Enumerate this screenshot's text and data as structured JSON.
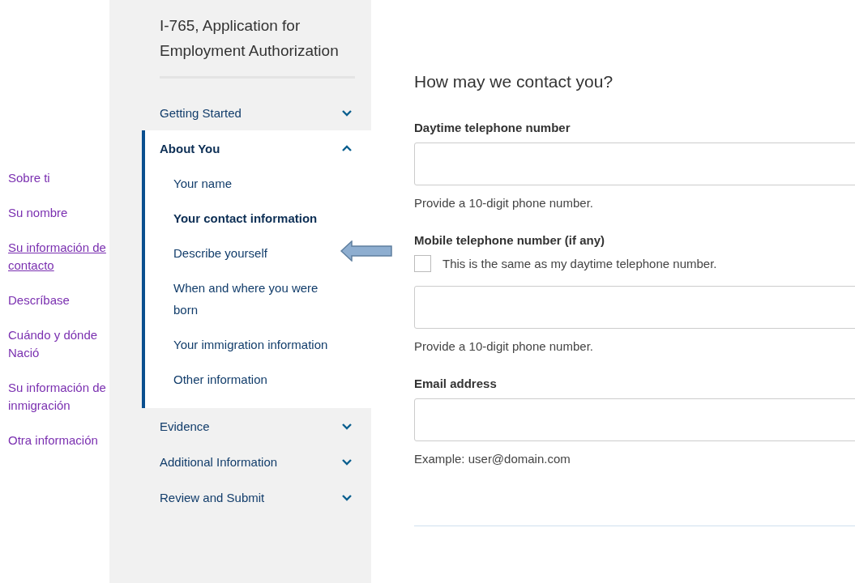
{
  "annotations": [
    {
      "label": "Sobre ti",
      "selected": false
    },
    {
      "label": "Su nombre",
      "selected": false
    },
    {
      "label": "Su información de contacto",
      "selected": true
    },
    {
      "label": "Descríbase",
      "selected": false
    },
    {
      "label": "Cuándo y dónde Nació",
      "selected": false
    },
    {
      "label": "Su información de inmigración",
      "selected": false
    },
    {
      "label": "Otra información",
      "selected": false
    }
  ],
  "sidebar": {
    "title": "I-765, Application for Employment Authorization",
    "sections": [
      {
        "label": "Getting Started",
        "expanded": false
      },
      {
        "label": "About You",
        "expanded": true,
        "items": [
          {
            "label": "Your name",
            "selected": false
          },
          {
            "label": "Your contact information",
            "selected": true
          },
          {
            "label": "Describe yourself",
            "selected": false
          },
          {
            "label": "When and where you were born",
            "selected": false
          },
          {
            "label": "Your immigration information",
            "selected": false
          },
          {
            "label": "Other information",
            "selected": false
          }
        ]
      },
      {
        "label": "Evidence",
        "expanded": false
      },
      {
        "label": "Additional Information",
        "expanded": false
      },
      {
        "label": "Review and Submit",
        "expanded": false
      }
    ]
  },
  "form": {
    "heading": "How may we contact you?",
    "fields": [
      {
        "label": "Daytime telephone number",
        "hint": "Provide a 10-digit phone number."
      },
      {
        "label": "Mobile telephone number (if any)",
        "checkbox": {
          "label": "This is the same as my daytime telephone number.",
          "checked": false
        },
        "hint": "Provide a 10-digit phone number."
      },
      {
        "label": "Email address",
        "hint": "Example: user@domain.com"
      }
    ]
  }
}
